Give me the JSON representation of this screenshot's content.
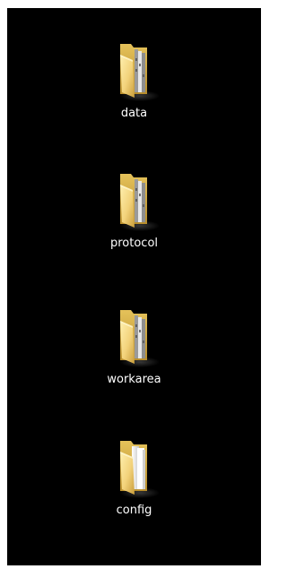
{
  "desktop": {
    "background_color": "#000000",
    "icons": [
      {
        "label": "data",
        "icon": "folder-with-documents-icon"
      },
      {
        "label": "protocol",
        "icon": "folder-with-documents-icon"
      },
      {
        "label": "workarea",
        "icon": "folder-with-documents-icon"
      },
      {
        "label": "config",
        "icon": "folder-with-white-pages-icon"
      }
    ]
  },
  "colors": {
    "folder_front": "#f0d27a",
    "folder_back": "#d9b04a",
    "folder_shadow": "#7a5c18",
    "page_white": "#f4f4f4",
    "page_gray": "#b8b8b8",
    "label_text": "#ffffff"
  }
}
